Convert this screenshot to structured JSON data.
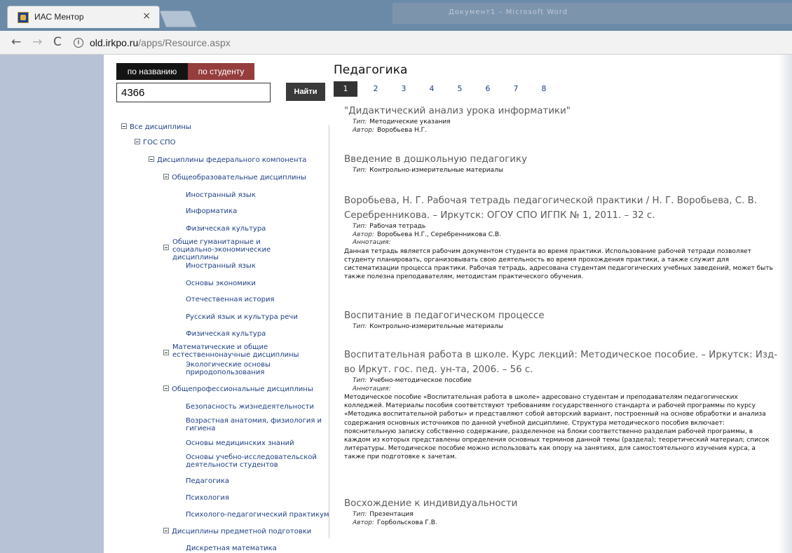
{
  "browser": {
    "tab_title": "ИАС Ментор",
    "tab_close": "×",
    "url_domain": "old.irkpo.ru",
    "url_path": "/apps/Resource.aspx",
    "background_window_title": "Документ1 – Microsoft Word",
    "nav_back": "←",
    "nav_forward": "→",
    "nav_reload": "C",
    "info_glyph": "i"
  },
  "search": {
    "tab_by_title": "по названию",
    "tab_by_student": "по студенту",
    "query": "4366",
    "button_label": "Найти"
  },
  "tree": [
    {
      "label": "Все дисциплины",
      "expandable": true
    },
    {
      "label": "ГОС СПО",
      "expandable": true
    },
    {
      "label": "Дисциплины федерального компонента",
      "expandable": true
    },
    {
      "label": "Общеобразовательные дисциплины",
      "expandable": true
    },
    {
      "label": "Иностранный язык",
      "expandable": false
    },
    {
      "label": "Информатика",
      "expandable": false
    },
    {
      "label": "Физическая культура",
      "expandable": false
    },
    {
      "label": "Общие гуманитарные и социально-экономические дисциплины",
      "expandable": true
    },
    {
      "label": "Иностранный язык",
      "expandable": false
    },
    {
      "label": "Основы экономики",
      "expandable": false
    },
    {
      "label": "Отечественная история",
      "expandable": false
    },
    {
      "label": "Русский язык и культура речи",
      "expandable": false
    },
    {
      "label": "Физическая культура",
      "expandable": false
    },
    {
      "label": "Математические и общие естественнонаучные дисциплины",
      "expandable": true
    },
    {
      "label": "Экологические основы природопользования",
      "expandable": false
    },
    {
      "label": "Общепрофессиональные дисциплины",
      "expandable": true
    },
    {
      "label": "Безопасность жизнедеятельности",
      "expandable": false
    },
    {
      "label": "Возрастная анатомия, физиология и гигиена",
      "expandable": false
    },
    {
      "label": "Основы медицинских знаний",
      "expandable": false
    },
    {
      "label": "Основы учебно-исследовательской деятельности студентов",
      "expandable": false
    },
    {
      "label": "Педагогика",
      "expandable": false
    },
    {
      "label": "Психология",
      "expandable": false
    },
    {
      "label": "Психолого-педагогический практикум",
      "expandable": false
    },
    {
      "label": "Дисциплины предметной подготовки",
      "expandable": true
    },
    {
      "label": "Дискретная математика",
      "expandable": false
    }
  ],
  "content": {
    "title": "Педагогика",
    "pages": [
      "1",
      "2",
      "3",
      "4",
      "5",
      "6",
      "7",
      "8"
    ],
    "current_page": "1",
    "labels": {
      "type": "Тип:",
      "author": "Автор:",
      "annotation": "Аннотация:"
    },
    "resources": [
      {
        "title": "\"Дидактический анализ урока информатики\"",
        "type": "Методические указания",
        "author": "Воробьева Н.Г."
      },
      {
        "title": "Введение в дошкольную педагогику",
        "type": "Контрольно-измерительные материалы"
      },
      {
        "title": "Воробьева, Н. Г. Рабочая тетрадь педагогической практики / Н. Г. Воробьева, С. В. Серебренникова. – Иркутск: ОГОУ СПО ИГПК № 1, 2011. – 32 с.",
        "type": "Рабочая тетрадь",
        "author": "Воробьева Н.Г., Серебренникова С.В.",
        "annotation": "Данная тетрадь является рабочим документом студента во время практики. Использование рабочей тетради позволяет студенту планировать, организовывать свою деятельность во время прохождения практики, а также служит для систематизации процесса практики. Рабочая тетрадь, адресована студентам педагогических учебных заведений, может быть также полезна преподавателям, методистам практического обучения."
      },
      {
        "title": "Воспитание в педагогическом процессе",
        "type": "Контрольно-измерительные материалы"
      },
      {
        "title": "Воспитательная работа в школе. Курс лекций: Методическое пособие. – Иркутск: Изд-во Иркут. гос. пед. ун-та, 2006. – 56 с.",
        "type": "Учебно-методическое пособие",
        "annotation": "Методическое пособие «Воспитательная работа в школе» адресовано студентам и преподавателям педагогических колледжей. Материалы пособия соответствуют требованиям государственного стандарта и рабочей программы по курсу «Методика воспитательной работы» и представляют собой авторский вариант, построенный на основе обработки и анализа содержания основных источников по данной учебной дисциплине. Структура методического пособия включает: пояснительную записку собственно содержание, разделенное на блоки соответственно разделам рабочей программы, в каждом из которых представлены определения основных терминов данной темы (раздела); теоретический материал; список литературы. Методическое пособие можно использовать как опору на занятиях, для самостоятельного изучения курса, а также при подготовке к зачетам."
      },
      {
        "title": "Восхождение к индивидуальности",
        "type": "Презентация",
        "author": "Горбольскова Г.В."
      }
    ]
  }
}
